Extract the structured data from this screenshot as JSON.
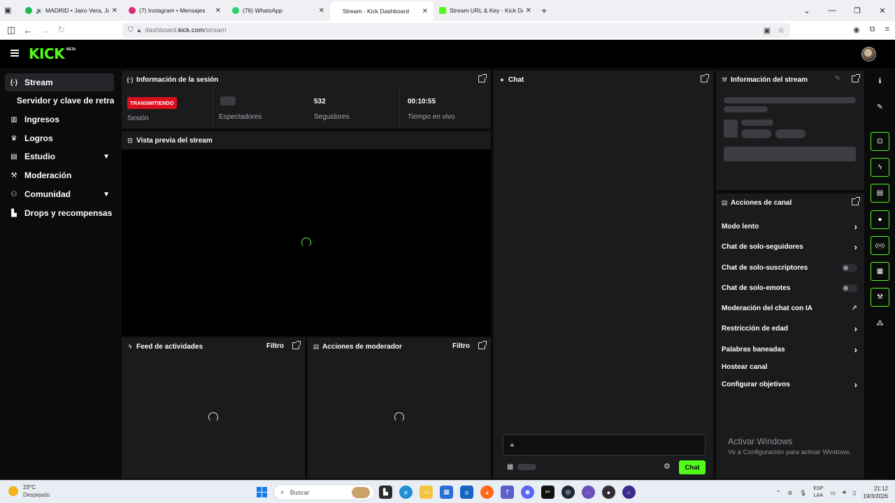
{
  "browser": {
    "tabs": [
      {
        "title": "MADRID • Jairo Vera, Juanki",
        "icon_color": "#1db954",
        "muted": true,
        "active": false
      },
      {
        "title": "(7) Instagram • Mensajes",
        "icon_color": "#d62976",
        "muted": false,
        "active": false
      },
      {
        "title": "(76) WhatsApp",
        "icon_color": "#25d366",
        "muted": false,
        "active": false
      },
      {
        "title": "Stream - Kick Dashboard",
        "icon_color": "",
        "muted": false,
        "active": true
      },
      {
        "title": "Stream URL & Key - Kick Dashb",
        "icon_color": "#53fc18",
        "muted": false,
        "active": false
      }
    ],
    "url_prefix": "dashboard.",
    "url_host": "kick.com",
    "url_path": "/stream"
  },
  "header": {
    "logo": "KICK",
    "beta": "BETA"
  },
  "sidebar": {
    "items": [
      {
        "label": "Stream",
        "icon": "broadcast-icon",
        "glyph": "(·)",
        "active": true,
        "chevron": false,
        "sub": false
      },
      {
        "label": "Servidor y clave de retransm",
        "icon": "",
        "glyph": "",
        "active": false,
        "chevron": false,
        "sub": true
      },
      {
        "label": "Ingresos",
        "icon": "chart-icon",
        "glyph": "▥",
        "active": false,
        "chevron": false,
        "sub": false
      },
      {
        "label": "Logros",
        "icon": "trophy-icon",
        "glyph": "🏆",
        "active": false,
        "chevron": false,
        "sub": false
      },
      {
        "label": "Estudio",
        "icon": "studio-icon",
        "glyph": "▤",
        "active": false,
        "chevron": true,
        "sub": false
      },
      {
        "label": "Moderación",
        "icon": "wrench-icon",
        "glyph": "🔧",
        "active": false,
        "chevron": false,
        "sub": false
      },
      {
        "label": "Comunidad",
        "icon": "users-icon",
        "glyph": "👥",
        "active": false,
        "chevron": true,
        "sub": false
      },
      {
        "label": "Drops y recompensas",
        "icon": "drops-icon",
        "glyph": "▙",
        "active": false,
        "chevron": false,
        "sub": false
      }
    ]
  },
  "session": {
    "title": "Información de la sesión",
    "live_badge": "TRANSMITIENDO",
    "session_label": "Sesión",
    "viewers_label": "Espectadores",
    "followers_value": "532",
    "followers_label": "Seguidores",
    "uptime_value": "00:10:55",
    "uptime_label": "Tiempo en vivo"
  },
  "preview": {
    "title": "Vista previa del stream"
  },
  "activity_feed": {
    "title": "Feed de actividades",
    "filter": "Filtro"
  },
  "mod_actions": {
    "title": "Acciones de moderador",
    "filter": "Filtro"
  },
  "chat": {
    "title": "Chat",
    "send_label": "Chat"
  },
  "stream_info": {
    "title": "Información del stream"
  },
  "channel_actions": {
    "title": "Acciones de canal",
    "items": [
      {
        "label": "Modo lento",
        "control": "arrow"
      },
      {
        "label": "Chat de solo-seguidores",
        "control": "arrow"
      },
      {
        "label": "Chat de solo-suscriptores",
        "control": "toggle",
        "on": false
      },
      {
        "label": "Chat de solo-emotes",
        "control": "toggle",
        "on": false
      },
      {
        "label": "Moderación del chat con IA",
        "control": "external"
      },
      {
        "label": "Restricción de edad",
        "control": "arrow"
      },
      {
        "label": "Palabras baneadas",
        "control": "arrow"
      },
      {
        "label": "Hostear canal",
        "control": "none"
      },
      {
        "label": "Configurar objetivos",
        "control": "arrow"
      }
    ]
  },
  "right_rail": {
    "buttons": [
      {
        "name": "info-icon",
        "glyph": "ℹ",
        "highlight": false
      },
      {
        "name": "edit-icon",
        "glyph": "✎",
        "highlight": false
      },
      {
        "name": "screen-capture-icon",
        "glyph": "⊡",
        "highlight": true
      },
      {
        "name": "lightning-icon",
        "glyph": "ϟ",
        "highlight": true
      },
      {
        "name": "notes-icon",
        "glyph": "▤",
        "highlight": true
      },
      {
        "name": "chat-bubble-icon",
        "glyph": "●",
        "highlight": true
      },
      {
        "name": "broadcast-icon",
        "glyph": "((•))",
        "highlight": true
      },
      {
        "name": "store-icon",
        "glyph": "▦",
        "highlight": true
      },
      {
        "name": "wrench-icon",
        "glyph": "🔧",
        "highlight": true
      },
      {
        "name": "nodes-icon",
        "glyph": "⁂",
        "highlight": false
      }
    ]
  },
  "watermark": {
    "line1": "Activar Windows",
    "line2": "Ve a Configuración para activar Windows."
  },
  "taskbar": {
    "temperature": "23°C",
    "weather": "Despejado",
    "search_placeholder": "Buscar",
    "lang_top": "ESP",
    "lang_bottom": "LAA",
    "time": "21:12",
    "date": "19/3/2026"
  },
  "colors": {
    "accent": "#53fc18",
    "live": "#d90f1e",
    "panel": "#1a1b1d"
  }
}
